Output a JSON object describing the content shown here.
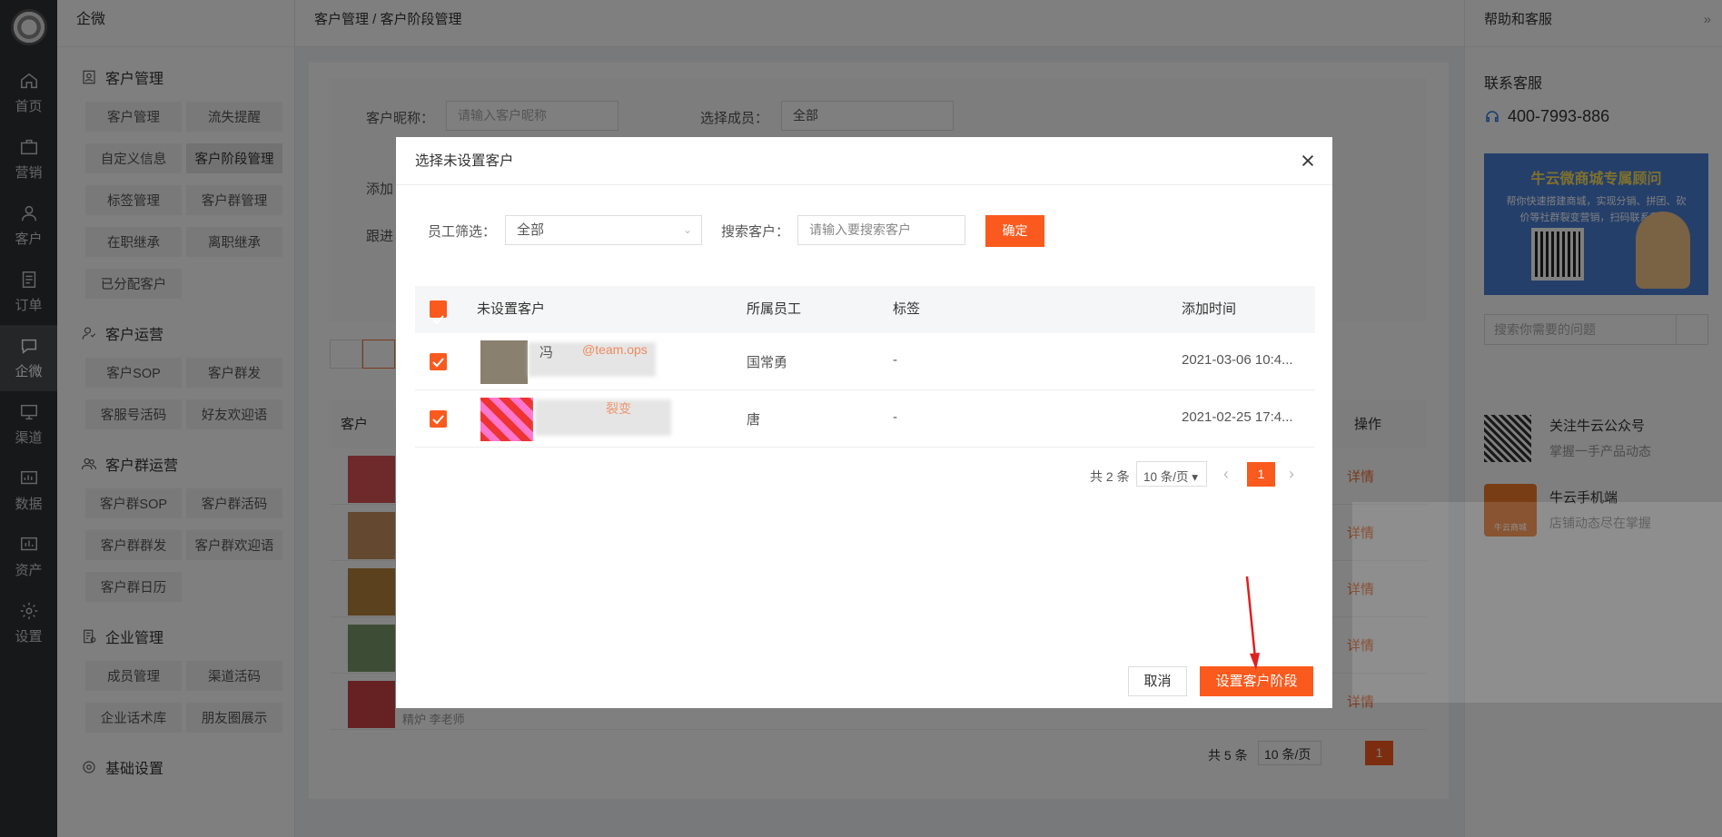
{
  "rail": {
    "items": [
      {
        "label": "首页",
        "icon": "home-icon"
      },
      {
        "label": "营销",
        "icon": "briefcase-icon"
      },
      {
        "label": "客户",
        "icon": "user-icon"
      },
      {
        "label": "订单",
        "icon": "order-icon"
      },
      {
        "label": "企微",
        "icon": "chat-icon",
        "active": true
      },
      {
        "label": "渠道",
        "icon": "monitor-icon"
      },
      {
        "label": "数据",
        "icon": "chart-icon"
      },
      {
        "label": "资产",
        "icon": "asset-icon"
      },
      {
        "label": "设置",
        "icon": "gear-icon"
      }
    ]
  },
  "menu": {
    "title": "企微",
    "sections": [
      {
        "title": "客户管理",
        "items": [
          "客户管理",
          "流失提醒",
          "自定义信息",
          "客户阶段管理",
          "标签管理",
          "客户群管理",
          "在职继承",
          "离职继承",
          "已分配客户"
        ]
      },
      {
        "title": "客户运营",
        "items": [
          "客户SOP",
          "客户群发",
          "客服号活码",
          "好友欢迎语"
        ]
      },
      {
        "title": "客户群运营",
        "items": [
          "客户群SOP",
          "客户群活码",
          "客户群群发",
          "客户群欢迎语",
          "客户群日历"
        ]
      },
      {
        "title": "企业管理",
        "items": [
          "成员管理",
          "渠道活码",
          "企业话术库",
          "朋友圈展示"
        ]
      },
      {
        "title": "基础设置",
        "items": []
      }
    ]
  },
  "breadcrumb": "客户管理 / 客户阶段管理",
  "page": {
    "nick_label": "客户昵称：",
    "nick_placeholder": "请输入客户昵称",
    "member_label": "选择成员：",
    "member_value": "全部",
    "add_label": "添加",
    "follow_label": "跟进",
    "col_customer": "客户",
    "col_action": "操作",
    "detail": "详情",
    "row_note": "精炉 李老师",
    "total": "共 5 条",
    "page_size": "10 条/页",
    "page": "1"
  },
  "help": {
    "title": "帮助和客服",
    "contact_title": "联系客服",
    "phone": "400-7993-886",
    "banner_title": "牛云微商城专属顾问",
    "banner_text1": "帮你快速搭建商城，实现分销、拼团、砍",
    "banner_text2": "价等社群裂变营销，扫码联系我吧!",
    "search_placeholder": "搜索你需要的问题",
    "wechat_title": "关注牛云公众号",
    "wechat_sub": "掌握一手产品动态",
    "app_title": "牛云手机端",
    "app_sub": "店铺动态尽在掌握",
    "app_logo_text": "牛云商城"
  },
  "modal": {
    "title": "选择未设置客户",
    "staff_label": "员工筛选：",
    "staff_value": "全部",
    "search_label": "搜索客户：",
    "search_placeholder": "请输入要搜索客户",
    "confirm": "确定",
    "headers": [
      "未设置客户",
      "所属员工",
      "标签",
      "添加时间"
    ],
    "rows": [
      {
        "name_partial": "冯",
        "name_tag": "@team.ops",
        "staff": "国常勇",
        "tag": "-",
        "time": "2021-03-06 10:4..."
      },
      {
        "name_partial": "",
        "name_tag": "裂变",
        "staff": "唐",
        "tag": "-",
        "time": "2021-02-25 17:4..."
      }
    ],
    "total": "共 2 条",
    "page_size": "10 条/页",
    "page": "1",
    "cancel": "取消",
    "submit": "设置客户阶段"
  }
}
